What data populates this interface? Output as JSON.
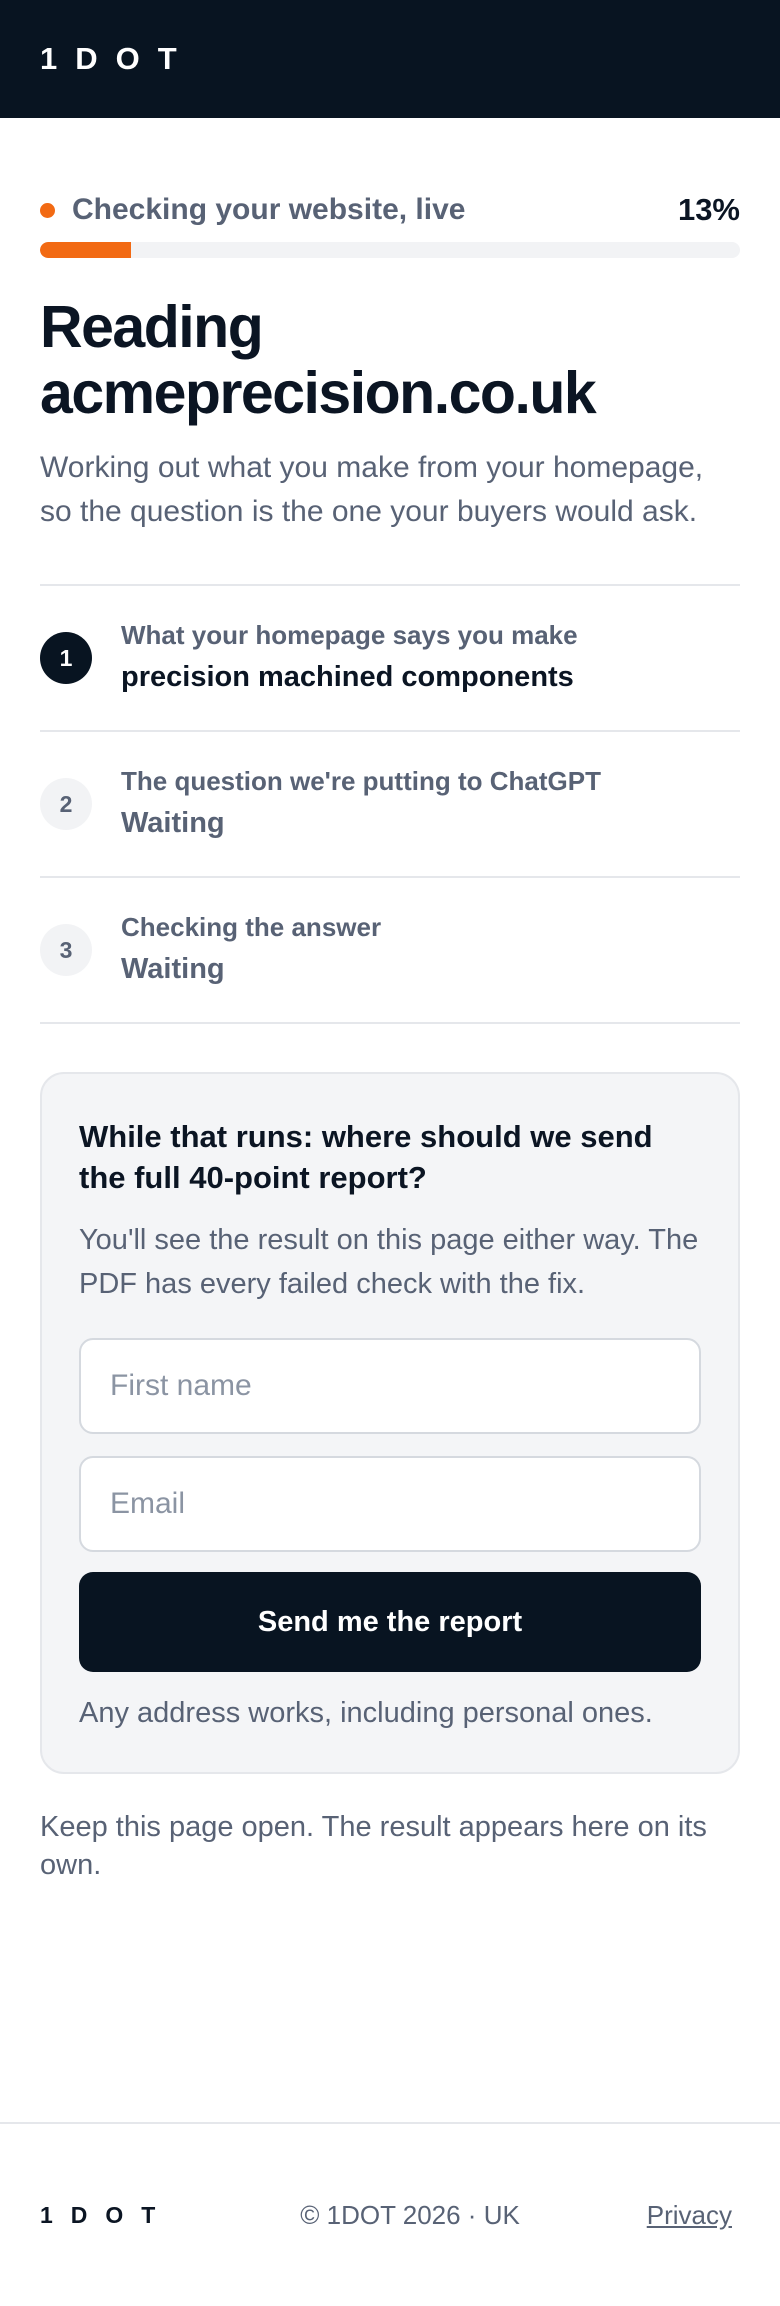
{
  "header": {
    "logo": "1DOT"
  },
  "progress": {
    "status": "Checking your website, live",
    "percent_label": "13%",
    "percent": 13,
    "accent_color": "#f26a13"
  },
  "headline": {
    "line1": "Reading",
    "line2": "acmeprecision.co.uk"
  },
  "subtext": "Working out what you make from your homepage, so the question is the one your buyers would ask.",
  "steps": [
    {
      "number": "1",
      "label": "What your homepage says you make",
      "value": "precision machined components",
      "state": "done"
    },
    {
      "number": "2",
      "label": "The question we're putting to ChatGPT",
      "value": "Waiting",
      "state": "waiting"
    },
    {
      "number": "3",
      "label": "Checking the answer",
      "value": "Waiting",
      "state": "waiting"
    }
  ],
  "form": {
    "title": "While that runs: where should we send the full 40-point report?",
    "description": "You'll see the result on this page either way. The PDF has every failed check with the fix.",
    "first_name_placeholder": "First name",
    "first_name_value": "",
    "email_placeholder": "Email",
    "email_value": "",
    "submit_label": "Send me the report",
    "note": "Any address works, including personal ones."
  },
  "keep_open": "Keep this page open. The result appears here on its own.",
  "footer": {
    "logo": "1DOT",
    "copyright": "© 1DOT 2026 · UK",
    "privacy_label": "Privacy"
  }
}
